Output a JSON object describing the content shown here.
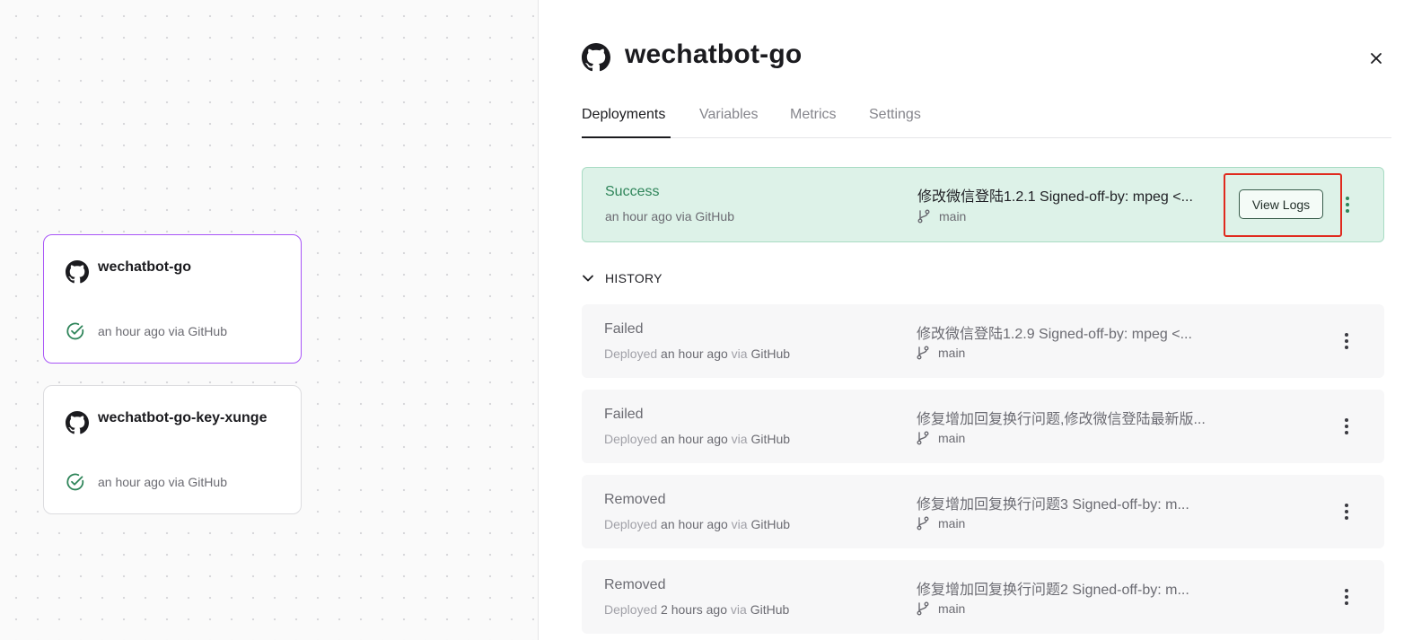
{
  "services": [
    {
      "name": "wechatbot-go",
      "meta": "an hour ago via GitHub",
      "icon": "github-icon",
      "status_icon": "check-circle-icon"
    },
    {
      "name": "wechatbot-go-key-xunge",
      "meta": "an hour ago via GitHub",
      "icon": "github-icon",
      "status_icon": "check-circle-icon"
    }
  ],
  "panel": {
    "title": "wechatbot-go",
    "tabs": [
      {
        "label": "Deployments",
        "active": true
      },
      {
        "label": "Variables"
      },
      {
        "label": "Metrics"
      },
      {
        "label": "Settings"
      }
    ]
  },
  "active_deployment": {
    "status": "Success",
    "time": "an hour ago",
    "via": "via",
    "source": "GitHub",
    "commit": "修改微信登陆1.2.1 Signed-off-by: mpeg <...",
    "branch": "main",
    "view_logs_label": "View Logs"
  },
  "history": {
    "label": "HISTORY",
    "items": [
      {
        "status": "Failed",
        "prefix": "Deployed",
        "time": "an hour ago",
        "via": "via",
        "source": "GitHub",
        "commit": "修改微信登陆1.2.9 Signed-off-by: mpeg <...",
        "branch": "main"
      },
      {
        "status": "Failed",
        "prefix": "Deployed",
        "time": "an hour ago",
        "via": "via",
        "source": "GitHub",
        "commit": "修复增加回复换行问题,修改微信登陆最新版...",
        "branch": "main"
      },
      {
        "status": "Removed",
        "prefix": "Deployed",
        "time": "an hour ago",
        "via": "via",
        "source": "GitHub",
        "commit": "修复增加回复换行问题3 Signed-off-by: m...",
        "branch": "main"
      },
      {
        "status": "Removed",
        "prefix": "Deployed",
        "time": "2 hours ago",
        "via": "via",
        "source": "GitHub",
        "commit": "修复增加回复换行问题2 Signed-off-by: m...",
        "branch": "main"
      }
    ]
  },
  "colors": {
    "success": "#2f855a",
    "success_bg": "#ddf2e8",
    "selected_border": "#a855f7",
    "highlight": "#e02a1e"
  }
}
